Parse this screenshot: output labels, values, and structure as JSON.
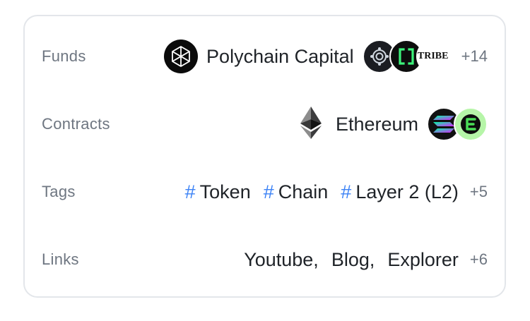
{
  "rows": {
    "funds": {
      "label": "Funds",
      "primary": "Polychain Capital",
      "stack_logos": [
        "tribe-bubble-logo",
        "bracket-logo",
        "tribe-wordmark-logo"
      ],
      "tribe_text": "TRIBE",
      "more": "+14"
    },
    "contracts": {
      "label": "Contracts",
      "chain": "Ethereum",
      "stack_logos": [
        "solana-logo",
        "e-logo"
      ]
    },
    "tags": {
      "label": "Tags",
      "items": [
        {
          "hash": "#",
          "name": "Token"
        },
        {
          "hash": "#",
          "name": "Chain"
        },
        {
          "hash": "#",
          "name": "Layer 2 (L2)"
        }
      ],
      "more": "+5"
    },
    "links": {
      "label": "Links",
      "items": [
        "Youtube,",
        "Blog,",
        "Explorer"
      ],
      "more": "+6"
    }
  },
  "colors": {
    "label": "#6e7681",
    "text": "#1f2328",
    "hash": "#3b82f6",
    "border": "#e3e6ea",
    "e_logo_bg": "#b6f5a8",
    "e_logo_fg": "#1ea33a"
  }
}
